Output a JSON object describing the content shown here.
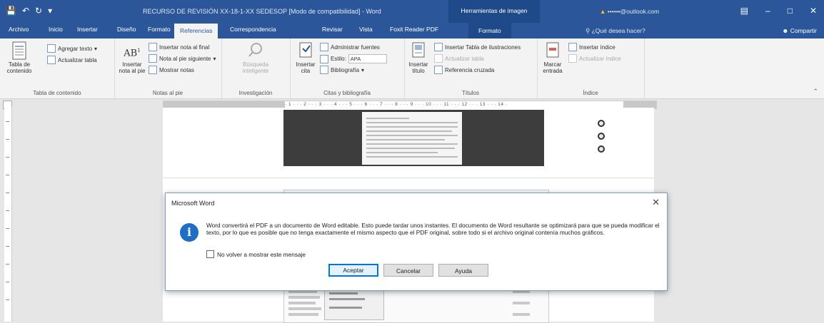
{
  "titlebar": {
    "document_title": "RECURSO DE REVISIÓN  XX-18-1-XX  SEDESOP [Modo de compatibilidad] - Word",
    "contextual_header": "Herramientas de imagen",
    "user": "••••••@outlook.com"
  },
  "tabs": {
    "archivo": "Archivo",
    "inicio": "Inicio",
    "insertar": "Insertar",
    "diseno": "Diseño",
    "formato": "Formato",
    "referencias": "Referencias",
    "correspondencia": "Correspondencia",
    "revisar": "Revisar",
    "vista": "Vista",
    "foxit": "Foxit Reader PDF",
    "formato_ctx": "Formato",
    "search": "¿Qué desea hacer?",
    "share": "Compartir"
  },
  "ribbon": {
    "toc": {
      "big": "Tabla de contenido",
      "add_text": "Agregar texto",
      "update_table": "Actualizar tabla",
      "label": "Tabla de contenido"
    },
    "footnotes": {
      "big": "Insertar nota al pie",
      "insert_endnote": "Insertar nota al final",
      "next_footnote": "Nota al pie siguiente",
      "show_notes": "Mostrar notas",
      "label": "Notas al pie"
    },
    "research": {
      "big": "Búsqueda inteligente",
      "label": "Investigación"
    },
    "citations": {
      "big": "Insertar cita",
      "manage_sources": "Administrar fuentes",
      "style_label": "Estilo:",
      "style_value": "APA",
      "bibliography": "Bibliografía",
      "label": "Citas y bibliografía"
    },
    "captions": {
      "big": "Insertar título",
      "insert_table_of_figures": "Insertar Tabla de ilustraciones",
      "update_table": "Actualizar tabla",
      "cross_reference": "Referencia cruzada",
      "label": "Títulos"
    },
    "index": {
      "big": "Marcar entrada",
      "insert_index": "Insertar índice",
      "update_index": "Actualizar índice",
      "label": "Índice"
    }
  },
  "dialog": {
    "title": "Microsoft Word",
    "message": "Word convertirá el PDF a un documento de Word editable. Esto puede tardar unos instantes. El documento de Word resultante se optimizará para que se pueda modificar el texto, por lo que es posible que no tenga exactamente el mismo aspecto que el PDF original, sobre todo si el archivo original contenía muchos gráficos.",
    "checkbox": "No volver a mostrar este mensaje",
    "ok": "Aceptar",
    "cancel": "Cancelar",
    "help": "Ayuda"
  },
  "colors": {
    "accent": "#2b579a",
    "info": "#1d6ec7"
  }
}
